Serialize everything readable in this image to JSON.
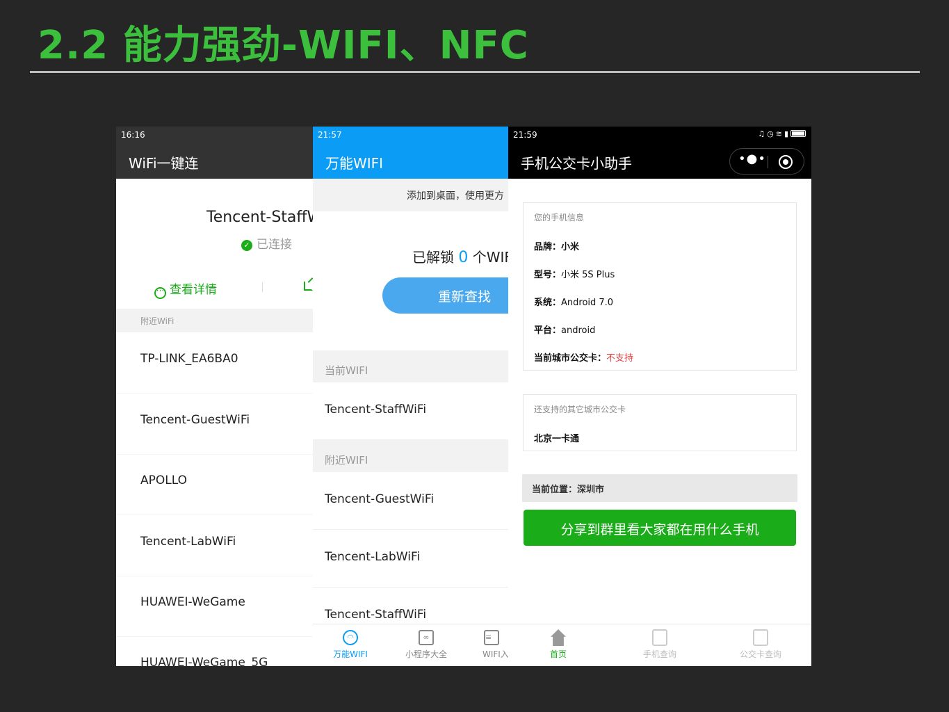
{
  "slide": {
    "title": "2.2 能力强劲-WIFI、NFC"
  },
  "phone1": {
    "time": "16:16",
    "title": "WiFi一键连",
    "ssid": "Tencent-StaffW",
    "status": "已连接",
    "detail_label": "查看详情",
    "section": "附近WiFi",
    "networks": [
      "TP-LINK_EA6BA0",
      "Tencent-GuestWiFi",
      "APOLLO",
      "Tencent-LabWiFi",
      "HUAWEI-WeGame",
      "HUAWEI-WeGame_5G"
    ]
  },
  "phone2": {
    "time": "21:57",
    "title": "万能WIFI",
    "banner": "添加到桌面，使用更方",
    "unlock_prefix": "已解锁",
    "unlock_count": "0",
    "unlock_suffix": "个WIF",
    "rescan": "重新查找",
    "current_section": "当前WIFI",
    "current": "Tencent-StaffWiFi",
    "nearby_section": "附近WIFI",
    "nearby": [
      "Tencent-GuestWiFi",
      "Tencent-LabWiFi",
      "Tencent-StaffWiFi"
    ],
    "tabs": [
      "万能WIFI",
      "小程序大全",
      "WIFI入"
    ]
  },
  "phone3": {
    "time": "21:59",
    "title": "手机公交卡小助手",
    "info_head": "您的手机信息",
    "brand_label": "品牌：",
    "brand": "小米",
    "model_label": "型号：",
    "model": "小米 5S Plus",
    "os_label": "系统：",
    "os": "Android 7.0",
    "platform_label": "平台：",
    "platform": "android",
    "card_label": "当前城市公交卡：",
    "card_status": "不支持",
    "other_head": "还支持的其它城市公交卡",
    "other_city": "北京一卡通",
    "location": "当前位置：深圳市",
    "share": "分享到群里看大家都在用什么手机",
    "tabs": [
      "首页",
      "手机查询",
      "公交卡查询"
    ],
    "accent": "#1aad19",
    "warn": "#e64340"
  }
}
